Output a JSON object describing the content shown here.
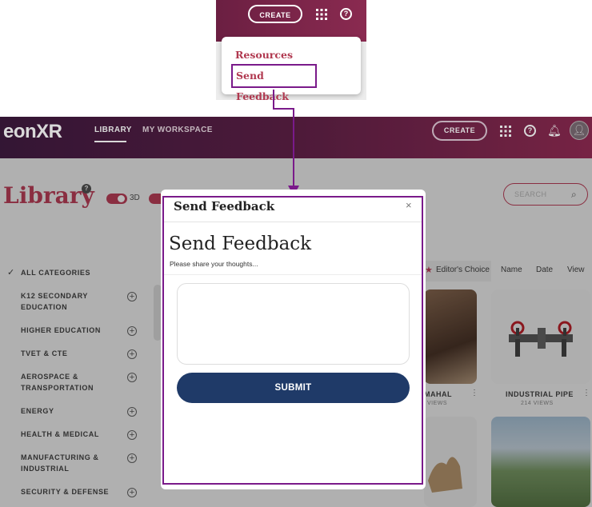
{
  "inset": {
    "create_label": "CREATE",
    "menu_items": [
      "Resources",
      "Send Feedback"
    ]
  },
  "header": {
    "logo_text": "eonXR",
    "nav": [
      "LIBRARY",
      "MY WORKSPACE"
    ],
    "create_label": "CREATE"
  },
  "library": {
    "title": "Library",
    "toggle_label": "3D",
    "search_placeholder": "SEARCH",
    "categories": [
      "ALL CATEGORIES",
      "K12 SECONDARY EDUCATION",
      "HIGHER EDUCATION",
      "TVET & CTE",
      "AEROSPACE & TRANSPORTATION",
      "ENERGY",
      "HEALTH & MEDICAL",
      "MANUFACTURING & INDUSTRIAL",
      "SECURITY & DEFENSE"
    ],
    "sort_tabs": [
      "Editor's Choice",
      "Name",
      "Date",
      "View"
    ],
    "cards": [
      {
        "title": "MAHAL",
        "views": "VIEWS"
      },
      {
        "title": "INDUSTRIAL PIPE",
        "views": "214 VIEWS"
      }
    ]
  },
  "modal": {
    "title": "Send Feedback",
    "close": "×",
    "heading": "Send Feedback",
    "subtitle": "Please share your thoughts...",
    "textarea_placeholder": "",
    "submit_label": "SUBMIT"
  },
  "colors": {
    "accent": "#c0405a",
    "highlight_border": "#7a1a8a",
    "submit_bg": "#1f3a68",
    "header_start": "#3d1a3e",
    "header_end": "#8c2a50"
  }
}
